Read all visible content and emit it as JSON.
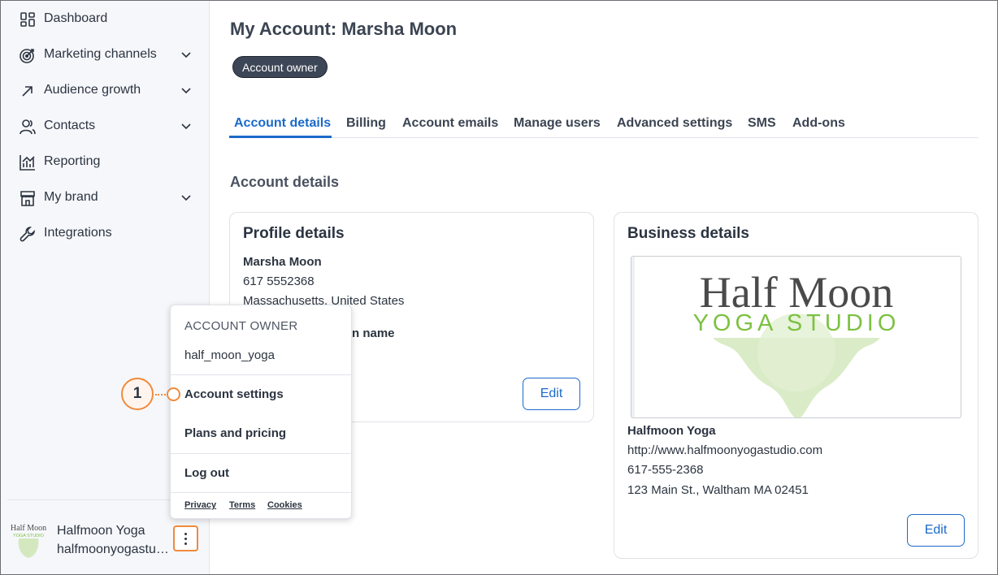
{
  "sidebar": {
    "items": [
      {
        "label": "Dashboard",
        "icon": "dashboard-icon",
        "expandable": false
      },
      {
        "label": "Marketing channels",
        "icon": "target-icon",
        "expandable": true
      },
      {
        "label": "Audience growth",
        "icon": "arrow-up-right-icon",
        "expandable": true
      },
      {
        "label": "Contacts",
        "icon": "contacts-icon",
        "expandable": true
      },
      {
        "label": "Reporting",
        "icon": "chart-icon",
        "expandable": false
      },
      {
        "label": "My brand",
        "icon": "storefront-icon",
        "expandable": true
      },
      {
        "label": "Integrations",
        "icon": "wrench-icon",
        "expandable": false
      }
    ],
    "account_name": "Halfmoon Yoga",
    "account_email": "halfmoonyogastudio"
  },
  "header": {
    "title": "My Account: Marsha Moon",
    "badge": "Account owner"
  },
  "tabs": [
    {
      "label": "Account details",
      "active": true
    },
    {
      "label": "Billing",
      "active": false
    },
    {
      "label": "Account emails",
      "active": false
    },
    {
      "label": "Manage users",
      "active": false
    },
    {
      "label": "Advanced settings",
      "active": false
    },
    {
      "label": "SMS",
      "active": false
    },
    {
      "label": "Add-ons",
      "active": false
    }
  ],
  "section_title": "Account details",
  "profile": {
    "title": "Profile details",
    "name": "Marsha Moon",
    "phone": "617 5552368",
    "location": "Massachusetts, United States",
    "partial_label": "n name",
    "edit_label": "Edit"
  },
  "business": {
    "title": "Business details",
    "logo_line1": "Half Moon",
    "logo_line2": "YOGA STUDIO",
    "name": "Halfmoon Yoga",
    "website": "http://www.halfmoonyogastudio.com",
    "phone": "617-555-2368",
    "address": "123 Main St., Waltham MA 02451",
    "edit_label": "Edit"
  },
  "menu": {
    "heading": "ACCOUNT OWNER",
    "username": "half_moon_yoga",
    "items": [
      "Account settings",
      "Plans and pricing",
      "Log out"
    ],
    "footer_links": [
      "Privacy",
      "Terms",
      "Cookies"
    ]
  },
  "callout": {
    "number": "1"
  },
  "colors": {
    "accent": "#1b6ac9",
    "badge_bg": "#3d4656",
    "highlight": "#f08a3c",
    "logo_green": "#7cc142",
    "logo_gray": "#4a4a4a"
  }
}
